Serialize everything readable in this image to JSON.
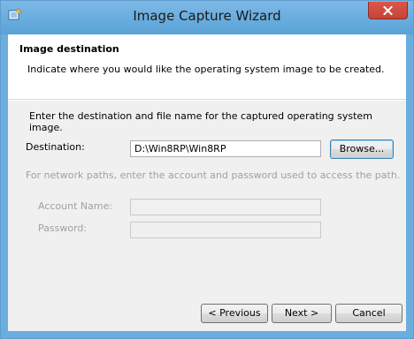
{
  "window": {
    "title": "Image Capture Wizard",
    "app_icon": "wizard-app-icon",
    "close_icon": "close-icon"
  },
  "header": {
    "title": "Image destination",
    "description": "Indicate where you would like the operating system image to be created."
  },
  "form": {
    "instruction": "Enter the destination and file name for the captured operating system image.",
    "destination_label": "Destination:",
    "destination_value": "D:\\Win8RP\\Win8RP",
    "browse_label": "Browse...",
    "network_note": "For network paths, enter the account and password used to access the path.",
    "account_label": "Account Name:",
    "account_value": "",
    "password_label": "Password:",
    "password_value": ""
  },
  "footer": {
    "previous_label": "< Previous",
    "next_label": "Next >",
    "cancel_label": "Cancel"
  },
  "colors": {
    "titlebar": "#6aaede",
    "close_button": "#c7433a",
    "disabled_text": "#a0a0a0"
  }
}
